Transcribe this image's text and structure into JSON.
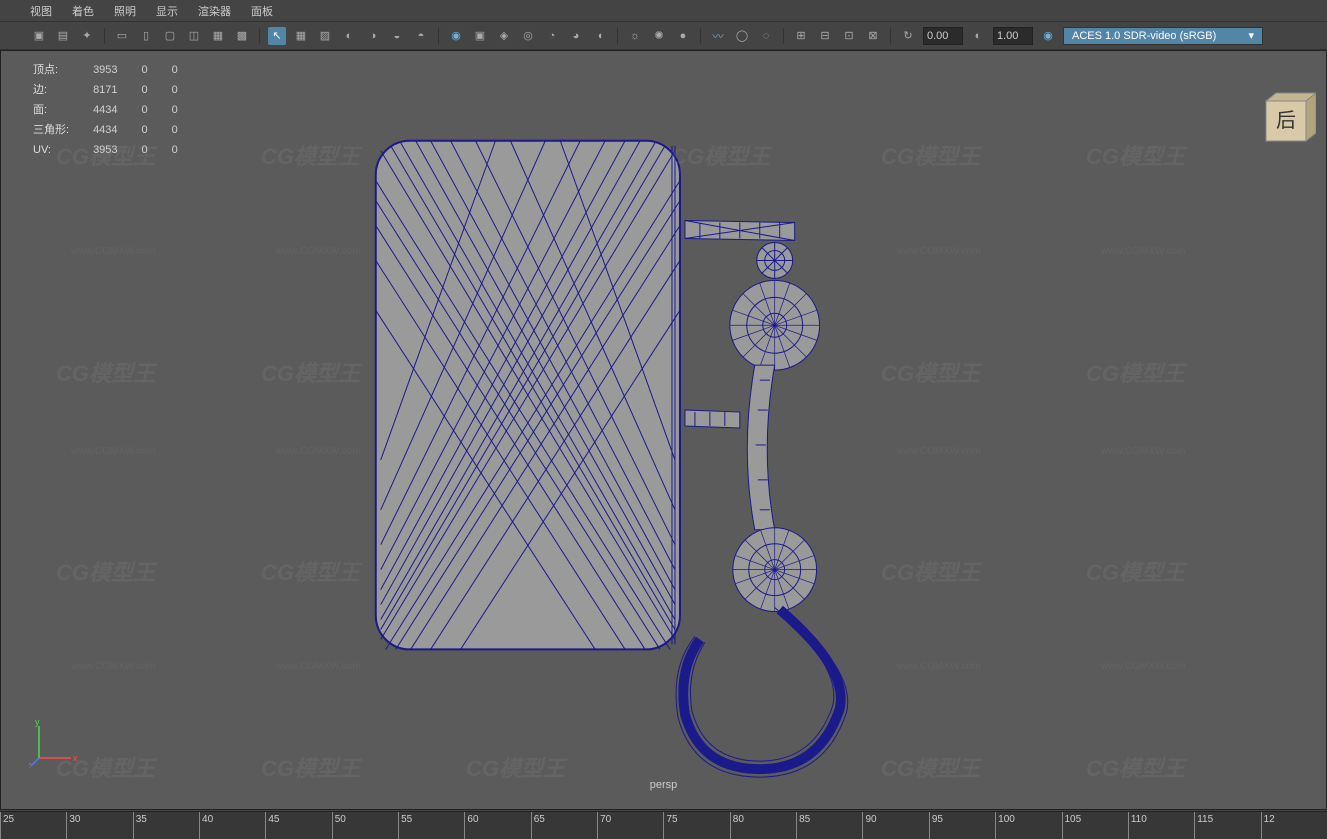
{
  "menus": {
    "view": "视图",
    "shading": "着色",
    "lighting": "照明",
    "show": "显示",
    "renderer": "渲染器",
    "panels": "面板"
  },
  "toolbar": {
    "value1": "0.00",
    "value2": "1.00",
    "color_transform": "ACES 1.0 SDR-video (sRGB)"
  },
  "hud": {
    "rows": [
      {
        "label": "顶点:",
        "a": "3953",
        "b": "0",
        "c": "0"
      },
      {
        "label": "边:",
        "a": "8171",
        "b": "0",
        "c": "0"
      },
      {
        "label": "面:",
        "a": "4434",
        "b": "0",
        "c": "0"
      },
      {
        "label": "三角形:",
        "a": "4434",
        "b": "0",
        "c": "0"
      },
      {
        "label": "UV:",
        "a": "3953",
        "b": "0",
        "c": "0"
      }
    ]
  },
  "viewcube": {
    "label": "后"
  },
  "axis": {
    "x": "x",
    "y": "y",
    "z": "z"
  },
  "camera": "persp",
  "timeline": {
    "ticks": [
      "25",
      "30",
      "35",
      "40",
      "45",
      "50",
      "55",
      "60",
      "65",
      "70",
      "75",
      "80",
      "85",
      "90",
      "95",
      "100",
      "105",
      "110",
      "115",
      "12"
    ]
  },
  "watermark": {
    "logo": "CG模型王",
    "url": "www.CGMXW.com"
  }
}
